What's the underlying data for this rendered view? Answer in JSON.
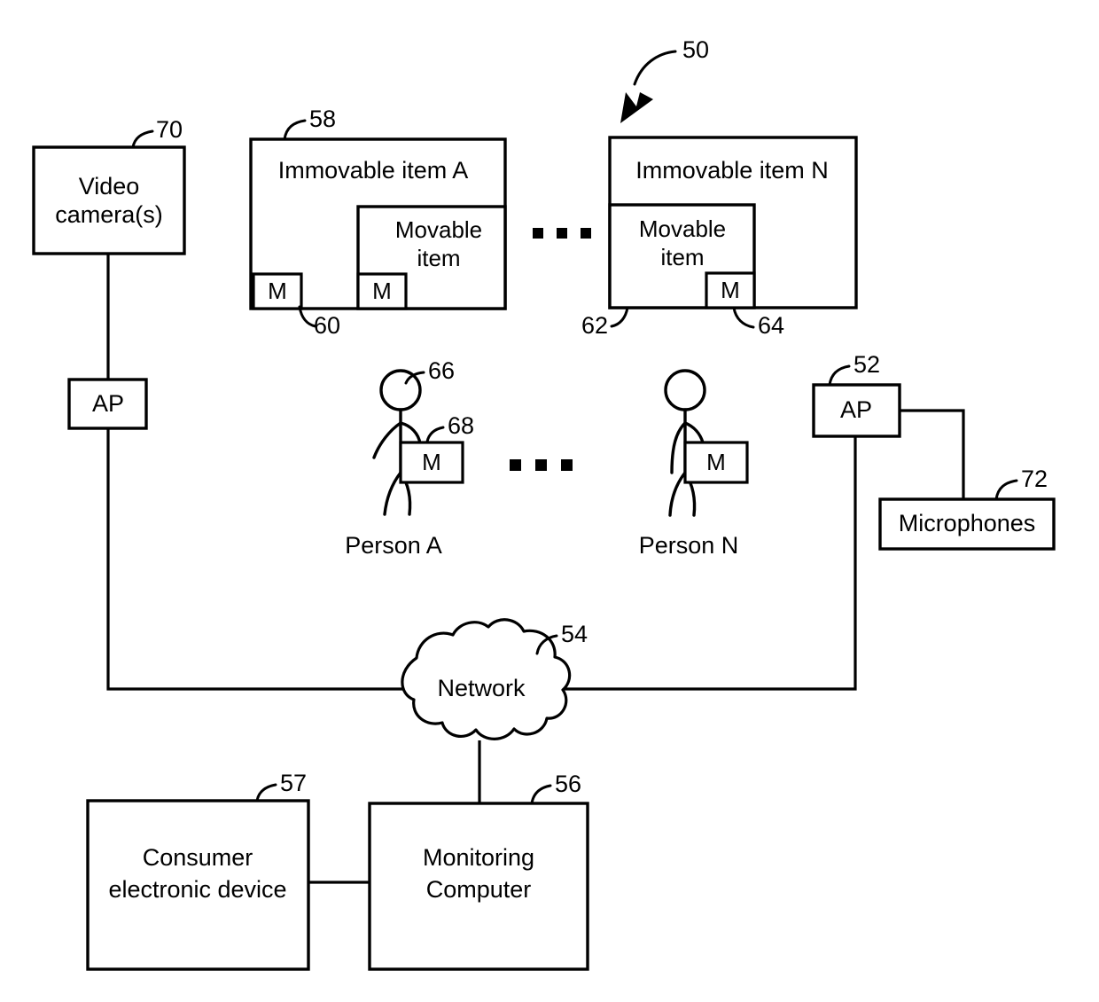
{
  "figure": {
    "kind": "patent-block-diagram",
    "overall_ref": "50",
    "background_color": "#ffffff",
    "line_color": "#000000"
  },
  "nodes": {
    "video_camera": {
      "label_line1": "Video",
      "label_line2": "camera(s)",
      "ref": "70"
    },
    "ap_left": {
      "label": "AP",
      "ref": ""
    },
    "ap_right": {
      "label": "AP",
      "ref": "52"
    },
    "microphones": {
      "label": "Microphones",
      "ref": "72"
    },
    "network": {
      "label": "Network",
      "ref": "54"
    },
    "monitoring_computer": {
      "label_line1": "Monitoring",
      "label_line2": "Computer",
      "ref": "56"
    },
    "consumer_device": {
      "label_line1": "Consumer",
      "label_line2": "electronic device",
      "ref": "57"
    },
    "immovable_a": {
      "label": "Immovable item A",
      "ref": "58",
      "tag_label": "M",
      "tag_ref": "60",
      "movable": {
        "label_line1": "Movable",
        "label_line2": "item",
        "tag_label": "M",
        "tag_ref": ""
      }
    },
    "immovable_n": {
      "label": "Immovable item N",
      "ref": "",
      "movable": {
        "label_line1": "Movable",
        "label_line2": "item",
        "ref": "62",
        "tag_label": "M",
        "tag_ref": "64"
      }
    },
    "person_a": {
      "label": "Person A",
      "head_ref": "66",
      "tag_label": "M",
      "tag_ref": "68"
    },
    "person_n": {
      "label": "Person N",
      "head_ref": "",
      "tag_label": "M",
      "tag_ref": ""
    }
  },
  "ellipses": {
    "items_row": "▪ ▪ ▪",
    "persons_row": "▪ ▪ ▪"
  },
  "refs": {
    "50": "50",
    "52": "52",
    "54": "54",
    "56": "56",
    "57": "57",
    "58": "58",
    "60": "60",
    "62": "62",
    "64": "64",
    "66": "66",
    "68": "68",
    "70": "70",
    "72": "72"
  }
}
